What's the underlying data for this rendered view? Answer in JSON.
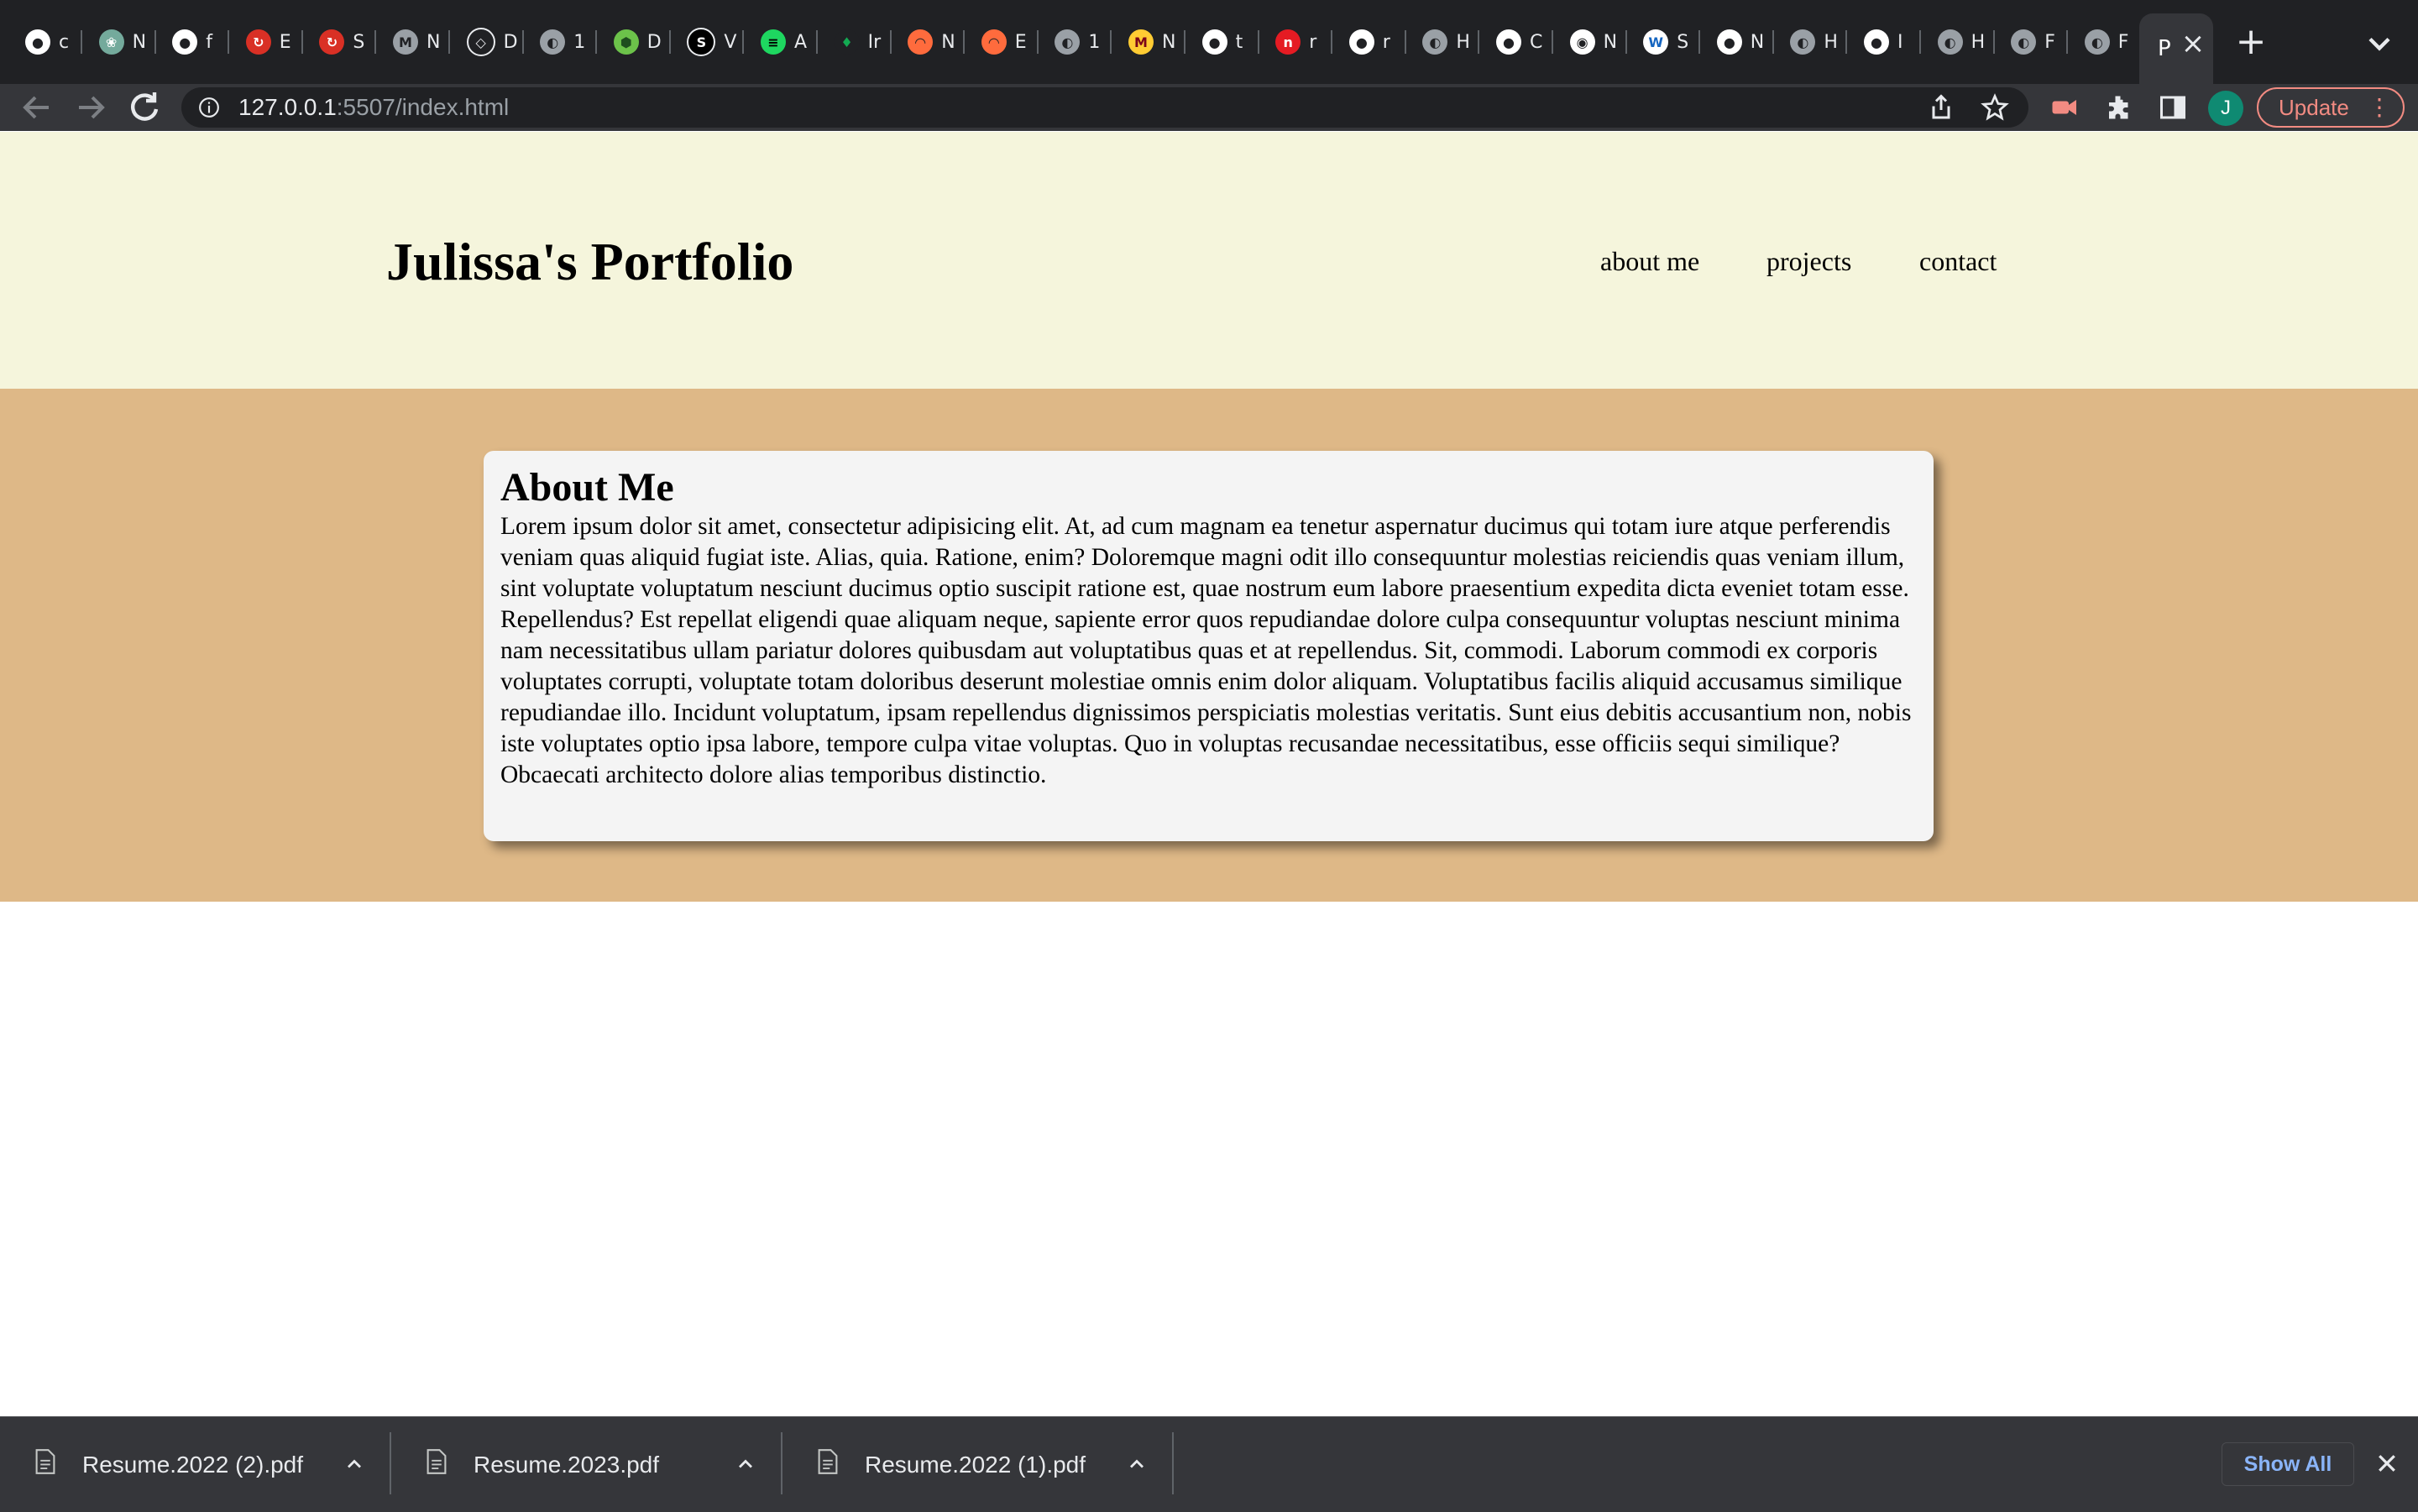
{
  "browser": {
    "tabs": [
      {
        "icon": "github-icon",
        "letter": "c"
      },
      {
        "icon": "openai-icon",
        "letter": "N"
      },
      {
        "icon": "github-icon",
        "letter": "f"
      },
      {
        "icon": "red-app-icon",
        "letter": "E"
      },
      {
        "icon": "red-app-icon",
        "letter": "S"
      },
      {
        "icon": "m-logo-icon",
        "letter": "N"
      },
      {
        "icon": "diamond-icon",
        "letter": "D"
      },
      {
        "icon": "globe-icon",
        "letter": "1"
      },
      {
        "icon": "green-hexagon-icon",
        "letter": "D"
      },
      {
        "icon": "s-logo-icon",
        "letter": "V"
      },
      {
        "icon": "spotify-icon",
        "letter": "A"
      },
      {
        "icon": "leaf-icon",
        "letter": "Ir"
      },
      {
        "icon": "hat-icon",
        "letter": "N"
      },
      {
        "icon": "hat-icon",
        "letter": "E"
      },
      {
        "icon": "globe-icon",
        "letter": "1"
      },
      {
        "icon": "m-gold-icon",
        "letter": "N"
      },
      {
        "icon": "github-icon",
        "letter": "t"
      },
      {
        "icon": "n-red-icon",
        "letter": "r"
      },
      {
        "icon": "github-icon",
        "letter": "r"
      },
      {
        "icon": "globe-icon",
        "letter": "H"
      },
      {
        "icon": "github-icon",
        "letter": "C"
      },
      {
        "icon": "chrome-icon",
        "letter": "N"
      },
      {
        "icon": "w3schools-icon",
        "letter": "S"
      },
      {
        "icon": "github-icon",
        "letter": "N"
      },
      {
        "icon": "globe-icon",
        "letter": "H"
      },
      {
        "icon": "github-icon",
        "letter": "I"
      },
      {
        "icon": "globe-icon",
        "letter": "H"
      },
      {
        "icon": "globe-icon",
        "letter": "F"
      },
      {
        "icon": "globe-icon",
        "letter": "F"
      }
    ],
    "active_tab": {
      "letter": "P"
    },
    "url_host": "127.0.0.1",
    "url_rest": ":5507/index.html",
    "avatar_letter": "J",
    "update_label": "Update",
    "colors": {
      "tab_strip": "#202124",
      "toolbar": "#35363a",
      "update_accent": "#f28b82"
    }
  },
  "page": {
    "header": {
      "title": "Julissa's Portfolio",
      "nav": [
        "about me",
        "projects",
        "contact"
      ]
    },
    "about": {
      "heading": "About Me",
      "body": "Lorem ipsum dolor sit amet, consectetur adipisicing elit. At, ad cum magnam ea tenetur aspernatur ducimus qui totam iure atque perferendis veniam quas aliquid fugiat iste. Alias, quia. Ratione, enim? Doloremque magni odit illo consequuntur molestias reiciendis quas veniam illum, sint voluptate voluptatum nesciunt ducimus optio suscipit ratione est, quae nostrum eum labore praesentium expedita dicta eveniet totam esse. Repellendus? Est repellat eligendi quae aliquam neque, sapiente error quos repudiandae dolore culpa consequuntur voluptas nesciunt minima nam necessitatibus ullam pariatur dolores quibusdam aut voluptatibus quas et at repellendus. Sit, commodi. Laborum commodi ex corporis voluptates corrupti, voluptate totam doloribus deserunt molestiae omnis enim dolor aliquam. Voluptatibus facilis aliquid accusamus similique repudiandae illo. Incidunt voluptatum, ipsam repellendus dignissimos perspiciatis molestias veritatis. Sunt eius debitis accusantium non, nobis iste voluptates optio ipsa labore, tempore culpa vitae voluptas. Quo in voluptas recusandae necessitatibus, esse officiis sequi similique? Obcaecati architecto dolore alias temporibus distinctio."
    },
    "colors": {
      "header_bg": "#f5f5dc",
      "about_bg": "#deb887",
      "card_bg": "#f4f4f4"
    }
  },
  "downloads": {
    "items": [
      {
        "filename": "Resume.2022 (2).pdf"
      },
      {
        "filename": "Resume.2023.pdf"
      },
      {
        "filename": "Resume.2022 (1).pdf"
      }
    ],
    "show_all_label": "Show All"
  }
}
